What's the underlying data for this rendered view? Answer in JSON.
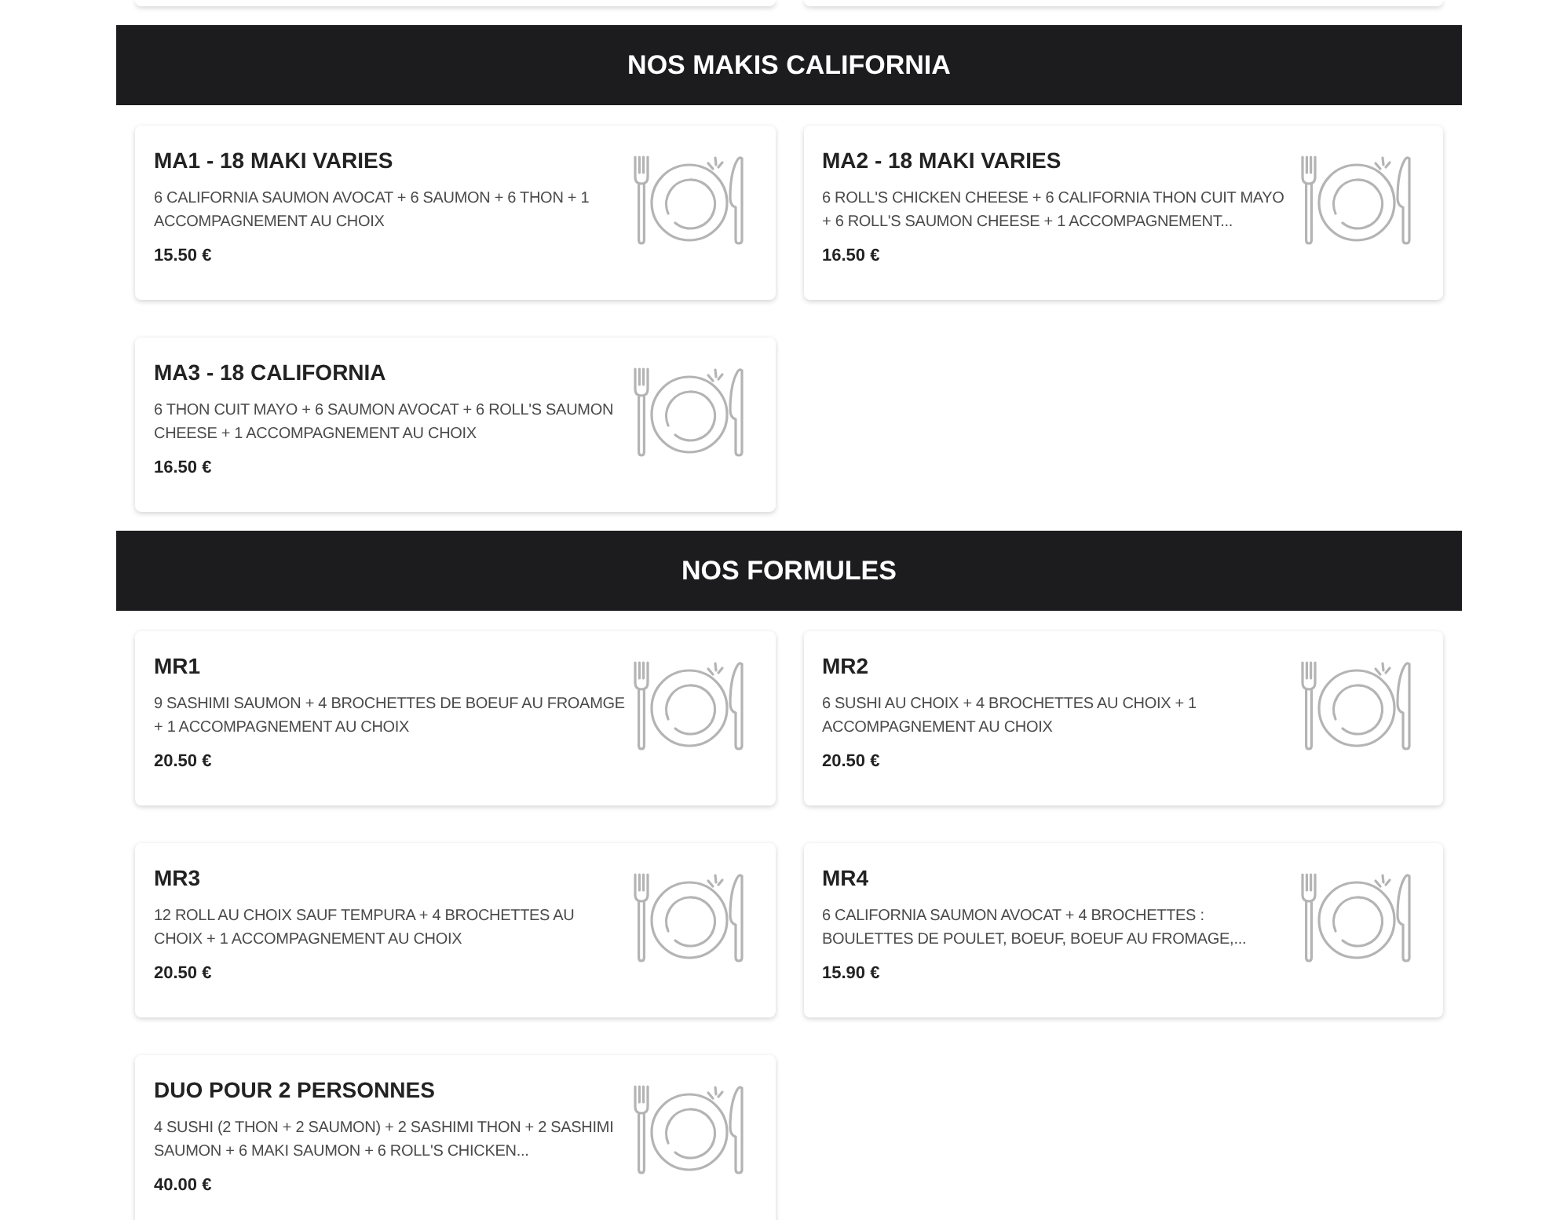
{
  "partial_cards": [
    {
      "kind": "card"
    },
    {
      "kind": "card"
    }
  ],
  "sections": [
    {
      "title": "NOS MAKIS CALIFORNIA",
      "items": [
        {
          "name": "MA1 - 18 MAKI VARIES",
          "description": "6 CALIFORNIA SAUMON AVOCAT + 6 SAUMON + 6 THON + 1 ACCOMPAGNEMENT AU CHOIX",
          "price": "15.50 €"
        },
        {
          "name": "MA2 - 18 MAKI VARIES",
          "description": "6 ROLL'S CHICKEN CHEESE + 6 CALIFORNIA THON CUIT MAYO + 6 ROLL'S SAUMON CHEESE + 1 ACCOMPAGNEMENT...",
          "price": "16.50 €"
        },
        {
          "name": "MA3 - 18 CALIFORNIA",
          "description": "6 THON CUIT MAYO + 6 SAUMON AVOCAT + 6 ROLL'S SAUMON CHEESE + 1 ACCOMPAGNEMENT AU CHOIX",
          "price": "16.50 €"
        }
      ]
    },
    {
      "title": "NOS FORMULES",
      "items": [
        {
          "name": "MR1",
          "description": "9 SASHIMI SAUMON + 4 BROCHETTES DE BOEUF AU FROAMGE + 1 ACCOMPAGNEMENT AU CHOIX",
          "price": "20.50 €"
        },
        {
          "name": "MR2",
          "description": "6 SUSHI AU CHOIX + 4 BROCHETTES AU CHOIX + 1 ACCOMPAGNEMENT AU CHOIX",
          "price": "20.50 €"
        },
        {
          "name": "MR3",
          "description": "12 ROLL AU CHOIX SAUF TEMPURA + 4 BROCHETTES AU CHOIX + 1 ACCOMPAGNEMENT AU CHOIX",
          "price": "20.50 €"
        },
        {
          "name": "MR4",
          "description": "6 CALIFORNIA SAUMON AVOCAT + 4 BROCHETTES : BOULETTES DE POULET, BOEUF, BOEUF AU FROMAGE,...",
          "price": "15.90 €"
        },
        {
          "name": "DUO POUR 2 PERSONNES",
          "description": "4 SUSHI (2 THON + 2 SAUMON) + 2 SASHIMI THON + 2 SASHIMI SAUMON + 6 MAKI SAUMON + 6 ROLL'S CHICKEN...",
          "price": "40.00 €"
        }
      ]
    }
  ]
}
